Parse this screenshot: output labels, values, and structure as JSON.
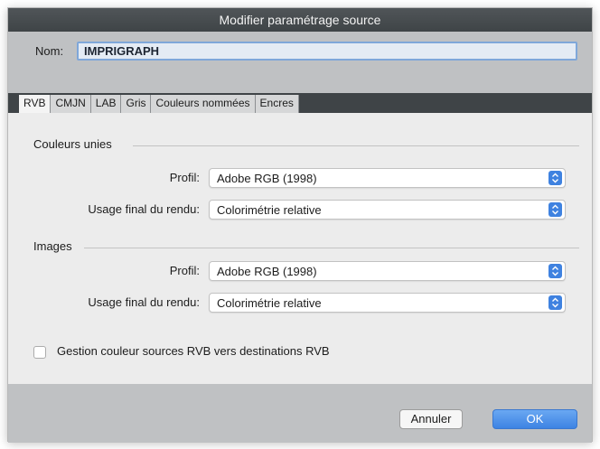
{
  "window": {
    "title": "Modifier paramétrage source"
  },
  "name_field": {
    "label": "Nom:",
    "value": "IMPRIGRAPH"
  },
  "tabs": [
    {
      "label": "RVB",
      "active": true
    },
    {
      "label": "CMJN",
      "active": false
    },
    {
      "label": "LAB",
      "active": false
    },
    {
      "label": "Gris",
      "active": false
    },
    {
      "label": "Couleurs nommées",
      "active": false
    },
    {
      "label": "Encres",
      "active": false
    }
  ],
  "solid_colors": {
    "group_label": "Couleurs unies",
    "profile_label": "Profil:",
    "profile_value": "Adobe RGB (1998)",
    "intent_label": "Usage final du rendu:",
    "intent_value": "Colorimétrie relative"
  },
  "images": {
    "group_label": "Images",
    "profile_label": "Profil:",
    "profile_value": "Adobe RGB (1998)",
    "intent_label": "Usage final du rendu:",
    "intent_value": "Colorimétrie relative"
  },
  "rgb_option": {
    "label": "Gestion couleur sources RVB vers destinations RVB",
    "checked": false
  },
  "buttons": {
    "cancel": "Annuler",
    "ok": "OK"
  },
  "colors": {
    "accent": "#3f82e0",
    "titlebar": "#444a4d",
    "panel": "#bfc1c3",
    "background": "#ececec"
  }
}
